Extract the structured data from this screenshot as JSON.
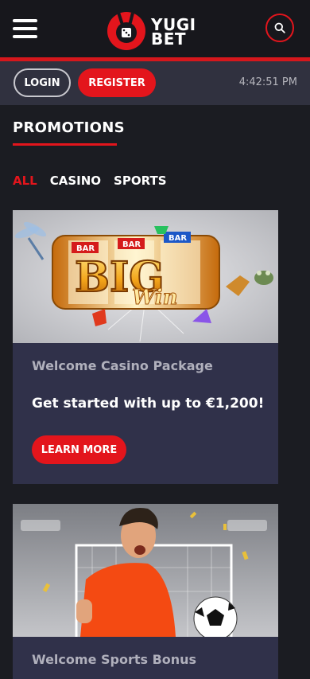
{
  "header": {
    "brand_line1": "YUGI",
    "brand_line2": "BET"
  },
  "auth": {
    "login_label": "LOGIN",
    "register_label": "REGISTER",
    "time": "4:42:51 PM"
  },
  "promotions": {
    "title": "PROMOTIONS",
    "filters": [
      {
        "label": "ALL",
        "active": true
      },
      {
        "label": "CASINO",
        "active": false
      },
      {
        "label": "SPORTS",
        "active": false
      }
    ]
  },
  "cards": [
    {
      "subtitle": "Welcome Casino Package",
      "headline": "Get started with up to €1,200!",
      "button_label": "LEARN MORE",
      "image_text": "BIG",
      "image_script": "Win",
      "reel_labels": [
        "BAR",
        "BAR",
        "BAR"
      ]
    },
    {
      "subtitle": "Welcome Sports Bonus"
    }
  ],
  "colors": {
    "accent": "#e3151c",
    "background": "#1b1c22",
    "card": "#30314a",
    "authbar": "#30313f"
  },
  "icons": [
    "menu-icon",
    "search-icon",
    "logo-icon"
  ]
}
